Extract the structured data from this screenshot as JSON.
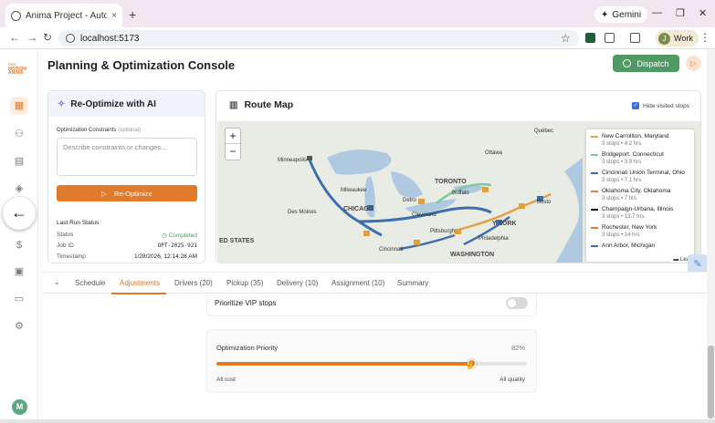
{
  "browser": {
    "tab_title": "Anima Project - Automatically c",
    "tab_close": "×",
    "new_tab": "+",
    "gemini": "Gemini",
    "url": "localhost:5173",
    "profile_initial": "J",
    "profile_label": "Work",
    "min": "—",
    "max": "❐",
    "close": "✕"
  },
  "header": {
    "title": "Planning & Optimization Console",
    "dispatch_label": "Dispatch",
    "logo_text": "MOTION ANIMA"
  },
  "sidebar": {
    "user_initial": "M",
    "icons": [
      "grid-icon",
      "users-icon",
      "clipboard-icon",
      "box-icon",
      "dollar-icon",
      "document-icon",
      "folder-icon",
      "gear-icon"
    ]
  },
  "reoptimize": {
    "title": "Re-Optimize with AI",
    "constraints_label": "Optimization Constraints",
    "constraints_optional": "(optional)",
    "textarea_placeholder": "Describe constraints or changes...",
    "button_label": "Re-Optimize",
    "last_run_title": "Last Run Status",
    "status_label": "Status",
    "status_value": "Completed",
    "job_label": "Job ID",
    "job_value": "OPT-2025-921",
    "timestamp_label": "Timestamp",
    "timestamp_value": "1/28/2026, 12:14:28 AM"
  },
  "route_map": {
    "title": "Route Map",
    "hide_visited": "Hide visited stops",
    "zoom_in": "+",
    "zoom_out": "−",
    "attribution": "Leaflet",
    "labels": {
      "minneapolis": "Minneapolis",
      "milwaukee": "Milwaukee",
      "chicago": "CHICAGO",
      "des_moines": "Des Moines",
      "detroit": "Detro",
      "cleveland": "Cleveland",
      "toronto": "TORONTO",
      "buffalo": "Buffalo",
      "ottawa": "Ottawa",
      "quebec": "Québec",
      "pittsburgh": "Pittsburgh",
      "philadelphia": "Philadelphia",
      "washington": "WASHINGTON",
      "cincinnati": "Cincinnati",
      "boston": "Bosto",
      "new_york": "Y YORK",
      "states": "ED STATES"
    },
    "legend": [
      {
        "name": "New Carrollton, Maryland",
        "meta": "3 stops • 4.2 hrs",
        "color": "#e6a04a"
      },
      {
        "name": "Bridgeport, Connecticut",
        "meta": "3 stops • 3.9 hrs",
        "color": "#7fc7a5"
      },
      {
        "name": "Cincinnati Union Terminal, Ohio",
        "meta": "3 stops • 7.1 hrs",
        "color": "#3d6fae"
      },
      {
        "name": "Oklahoma City, Oklahoma",
        "meta": "3 stops • 7 hrs",
        "color": "#e0843a"
      },
      {
        "name": "Champaign-Urbana, Illinois",
        "meta": "3 stops • 13.7 hrs",
        "color": "#111111"
      },
      {
        "name": "Rochester, New York",
        "meta": "3 stops • 14 hrs",
        "color": "#e07b2e"
      },
      {
        "name": "Ann Arbor, Michigan",
        "meta": "",
        "color": "#3d6fae"
      }
    ]
  },
  "tabs": {
    "schedule": "Schedule",
    "adjustments": "Adjustments",
    "drivers": "Drivers (20)",
    "pickup": "Pickup (35)",
    "delivery": "Delivery (10)",
    "assignment": "Assignment (10)",
    "summary": "Summary"
  },
  "adjustments": {
    "vip_label": "Prioritize VIP stops",
    "vip_enabled": false,
    "priority_label": "Optimization Priority",
    "priority_value_text": "82%",
    "priority_value": 0.82,
    "min_label": "All cost",
    "max_label": "All quality"
  },
  "colors": {
    "accent": "#e07b2e",
    "dispatch": "#4f9a63",
    "blue_route": "#3d6fae"
  }
}
